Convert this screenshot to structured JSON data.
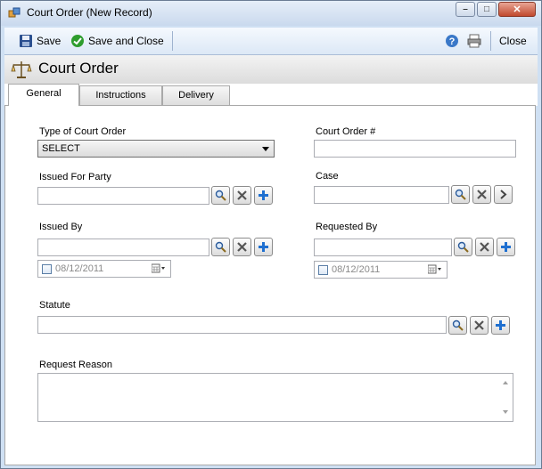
{
  "window": {
    "title": "Court Order (New Record)",
    "controls": {
      "minimize": "–",
      "maximize": "□",
      "close": "✕"
    }
  },
  "toolbar": {
    "save_label": "Save",
    "save_close_label": "Save and Close",
    "close_label": "Close"
  },
  "header": {
    "title": "Court Order"
  },
  "tabs": [
    {
      "label": "General",
      "active": true
    },
    {
      "label": "Instructions",
      "active": false
    },
    {
      "label": "Delivery",
      "active": false
    }
  ],
  "form": {
    "type_of_court_order": {
      "label": "Type of Court Order",
      "value": "SELECT"
    },
    "court_order_number": {
      "label": "Court Order #",
      "value": ""
    },
    "issued_for_party": {
      "label": "Issued For Party",
      "value": ""
    },
    "case": {
      "label": "Case",
      "value": ""
    },
    "issued_by": {
      "label": "Issued By",
      "value": "",
      "date": "08/12/2011"
    },
    "requested_by": {
      "label": "Requested By",
      "value": "",
      "date": "08/12/2011"
    },
    "statute": {
      "label": "Statute",
      "value": ""
    },
    "request_reason": {
      "label": "Request Reason",
      "value": ""
    }
  },
  "colors": {
    "accent_blue": "#1e6fd0",
    "save_icon": "#2a4f8f",
    "check_green": "#2e9d2e",
    "window_chrome": "#cfe0f3"
  }
}
